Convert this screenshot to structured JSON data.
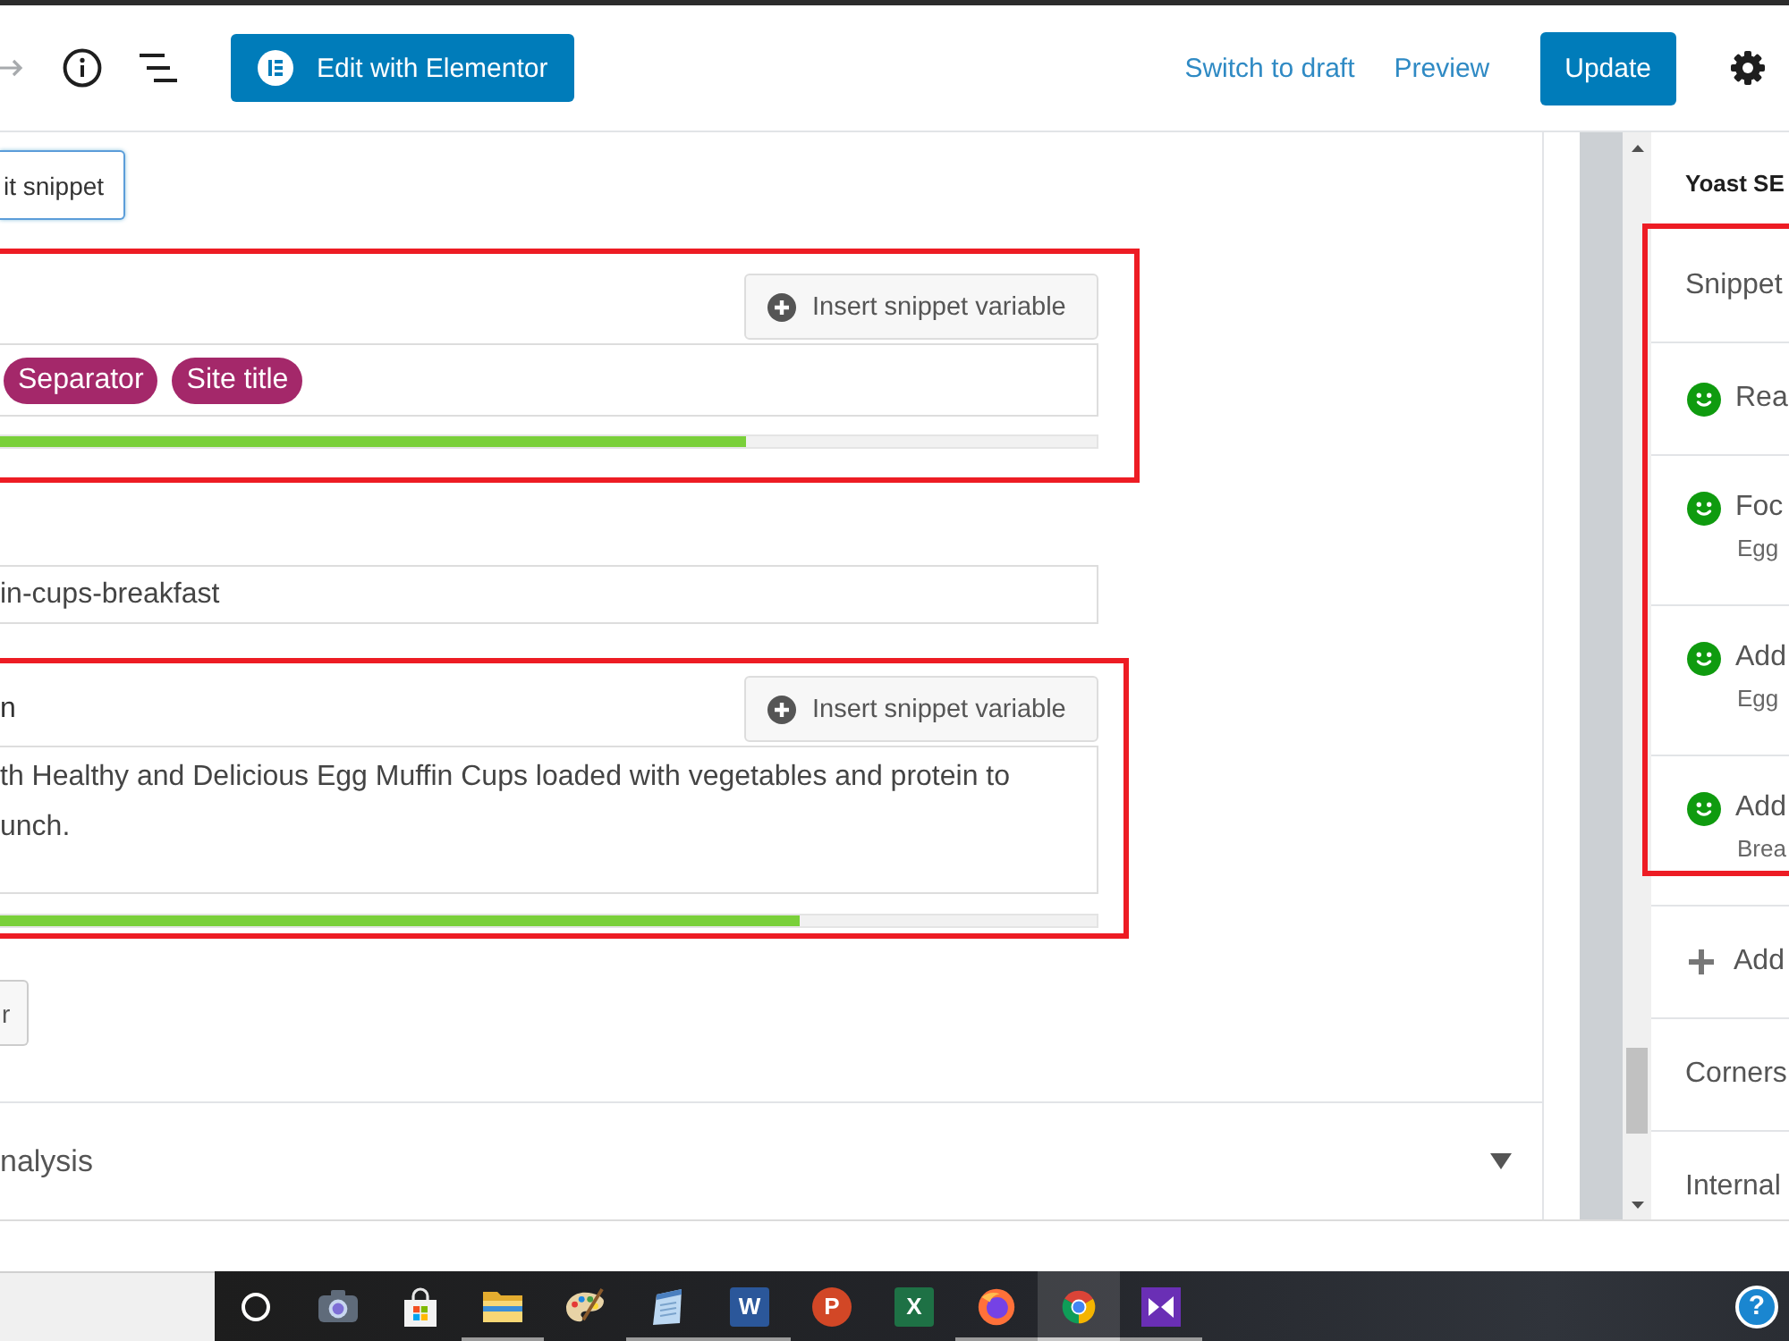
{
  "header": {
    "redo": {
      "disabled": true
    },
    "elementor_button": "Edit with Elementor",
    "links": [
      "Switch to draft",
      "Preview"
    ],
    "primary_button": "Update"
  },
  "snippet_editor": {
    "toggle_button": "it snippet",
    "title_field": {
      "highlighted": true,
      "insert_button": "Insert snippet variable",
      "tags": [
        "Separator",
        "Site title"
      ],
      "level": 0.68
    },
    "slug_field": {
      "value": "in-cups-breakfast"
    },
    "description_field": {
      "highlighted": true,
      "label": "n",
      "insert_button": "Insert snippet variable",
      "lines": [
        "th Healthy and Delicious Egg Muffin Cups loaded with vegetables and protein to",
        "unch."
      ],
      "level": 0.73
    },
    "close_button": "r"
  },
  "analysis_section": {
    "title": "nalysis"
  },
  "sidebar": {
    "title": "Yoast SE",
    "sections": [
      {
        "highlighted": true,
        "items": [
          {
            "kind": "toggle",
            "label": "Snippet"
          },
          {
            "kind": "score",
            "label": "Rea",
            "color": "#0f9b0f"
          },
          {
            "kind": "score",
            "label": "Foc",
            "detail": "Egg",
            "color": "#0f9b0f"
          },
          {
            "kind": "score",
            "label": "Add",
            "detail": "Egg",
            "color": "#0f9b0f"
          },
          {
            "kind": "score",
            "label": "Add",
            "detail": "Brea",
            "color": "#0f9b0f"
          }
        ]
      },
      {
        "highlighted": false,
        "items": [
          {
            "kind": "add",
            "label": "Add"
          },
          {
            "kind": "toggle",
            "label": "Corners"
          },
          {
            "kind": "toggle",
            "label": "Internal"
          }
        ]
      }
    ]
  },
  "taskbar": {
    "apps": [
      {
        "kind": "ring",
        "running": false,
        "active": false
      },
      {
        "kind": "camera",
        "running": false,
        "active": false
      },
      {
        "kind": "bag",
        "running": false,
        "active": false
      },
      {
        "kind": "folder",
        "running": true,
        "active": false
      },
      {
        "kind": "palette",
        "running": false,
        "active": false
      },
      {
        "kind": "notepad",
        "running": true,
        "active": false
      },
      {
        "kind": "tile",
        "glyph": "W",
        "color": "#2b579a",
        "running": true,
        "active": false
      },
      {
        "kind": "disc",
        "glyph": "P",
        "color": "#d24726",
        "running": false,
        "active": false
      },
      {
        "kind": "tile",
        "glyph": "X",
        "color": "#1e7145",
        "running": false,
        "active": false
      },
      {
        "kind": "swirl",
        "running": true,
        "active": false
      },
      {
        "kind": "wheel",
        "running": true,
        "active": true
      },
      {
        "kind": "ribbon",
        "running": true,
        "active": false
      }
    ],
    "help": "?"
  }
}
